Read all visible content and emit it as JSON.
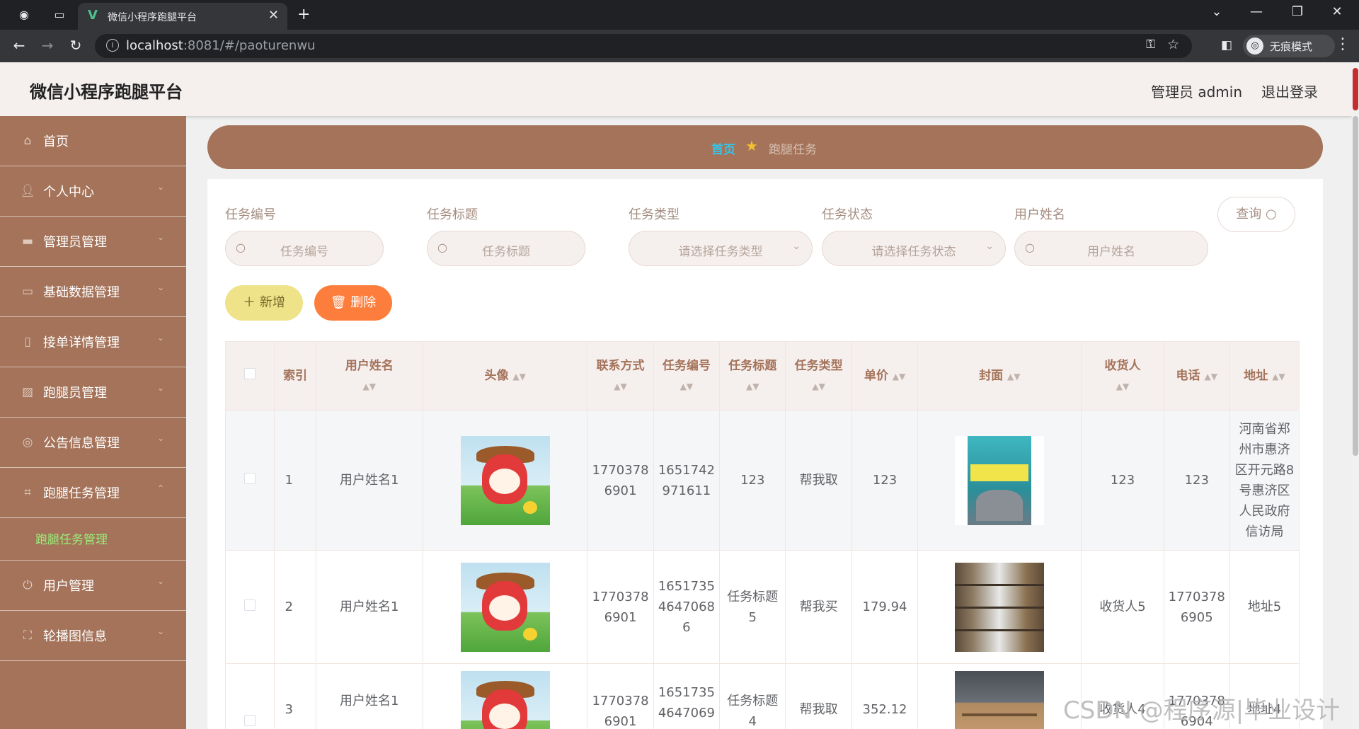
{
  "browser": {
    "tab_title": "微信小程序跑腿平台",
    "url_host": "localhost",
    "url_rest": ":8081/#/paoturenwu",
    "profile_label": "无痕模式"
  },
  "header": {
    "app_title": "微信小程序跑腿平台",
    "user_label": "管理员 admin",
    "logout_label": "退出登录"
  },
  "sidebar": {
    "items": [
      {
        "label": "首页",
        "icon": "home-icon"
      },
      {
        "label": "个人中心",
        "icon": "user-icon"
      },
      {
        "label": "管理员管理",
        "icon": "admin-icon"
      },
      {
        "label": "基础数据管理",
        "icon": "chat-icon"
      },
      {
        "label": "接单详情管理",
        "icon": "mobile-icon"
      },
      {
        "label": "跑腿员管理",
        "icon": "chart-icon"
      },
      {
        "label": "公告信息管理",
        "icon": "settings-icon"
      },
      {
        "label": "跑腿任务管理",
        "icon": "crop-icon"
      },
      {
        "label": "用户管理",
        "icon": "power-icon"
      },
      {
        "label": "轮播图信息",
        "icon": "fullscreen-icon"
      }
    ],
    "sub_active": "跑腿任务管理"
  },
  "breadcrumb": {
    "home": "首页",
    "current": "跑腿任务"
  },
  "search": {
    "fields": [
      {
        "label": "任务编号",
        "placeholder": "任务编号"
      },
      {
        "label": "任务标题",
        "placeholder": "任务标题"
      },
      {
        "label": "任务类型",
        "placeholder": "请选择任务类型"
      },
      {
        "label": "任务状态",
        "placeholder": "请选择任务状态"
      },
      {
        "label": "用户姓名",
        "placeholder": "用户姓名"
      }
    ],
    "query_label": "查询"
  },
  "actions": {
    "add_label": "新增",
    "delete_label": "删除"
  },
  "table": {
    "headers": [
      "索引",
      "用户姓名",
      "头像",
      "联系方式",
      "任务编号",
      "任务标题",
      "任务类型",
      "单价",
      "封面",
      "收货人",
      "电话",
      "地址"
    ],
    "rows": [
      {
        "index": "1",
        "user_name": "用户姓名1",
        "contact": "17703786901",
        "task_no": "1651742971611",
        "task_title": "123",
        "task_type": "帮我取",
        "price": "123",
        "receiver": "123",
        "phone": "123",
        "address": "河南省郑州市惠济区开元路8号惠济区人民政府信访局"
      },
      {
        "index": "2",
        "user_name": "用户姓名1",
        "contact": "17703786901",
        "task_no": "16517354647068 6",
        "task_title": "任务标题5",
        "task_type": "帮我买",
        "price": "179.94",
        "receiver": "收货人5",
        "phone": "17703786905",
        "address": "地址5"
      },
      {
        "index": "3",
        "user_name": "用户姓名1",
        "contact": "17703786901",
        "task_no": "16517354647069",
        "task_title": "任务标题4",
        "task_type": "帮我取",
        "price": "352.12",
        "receiver": "收货人4",
        "phone": "17703786904",
        "address": "地址4"
      }
    ]
  },
  "watermark": "CSDN @程序源|毕业设计"
}
